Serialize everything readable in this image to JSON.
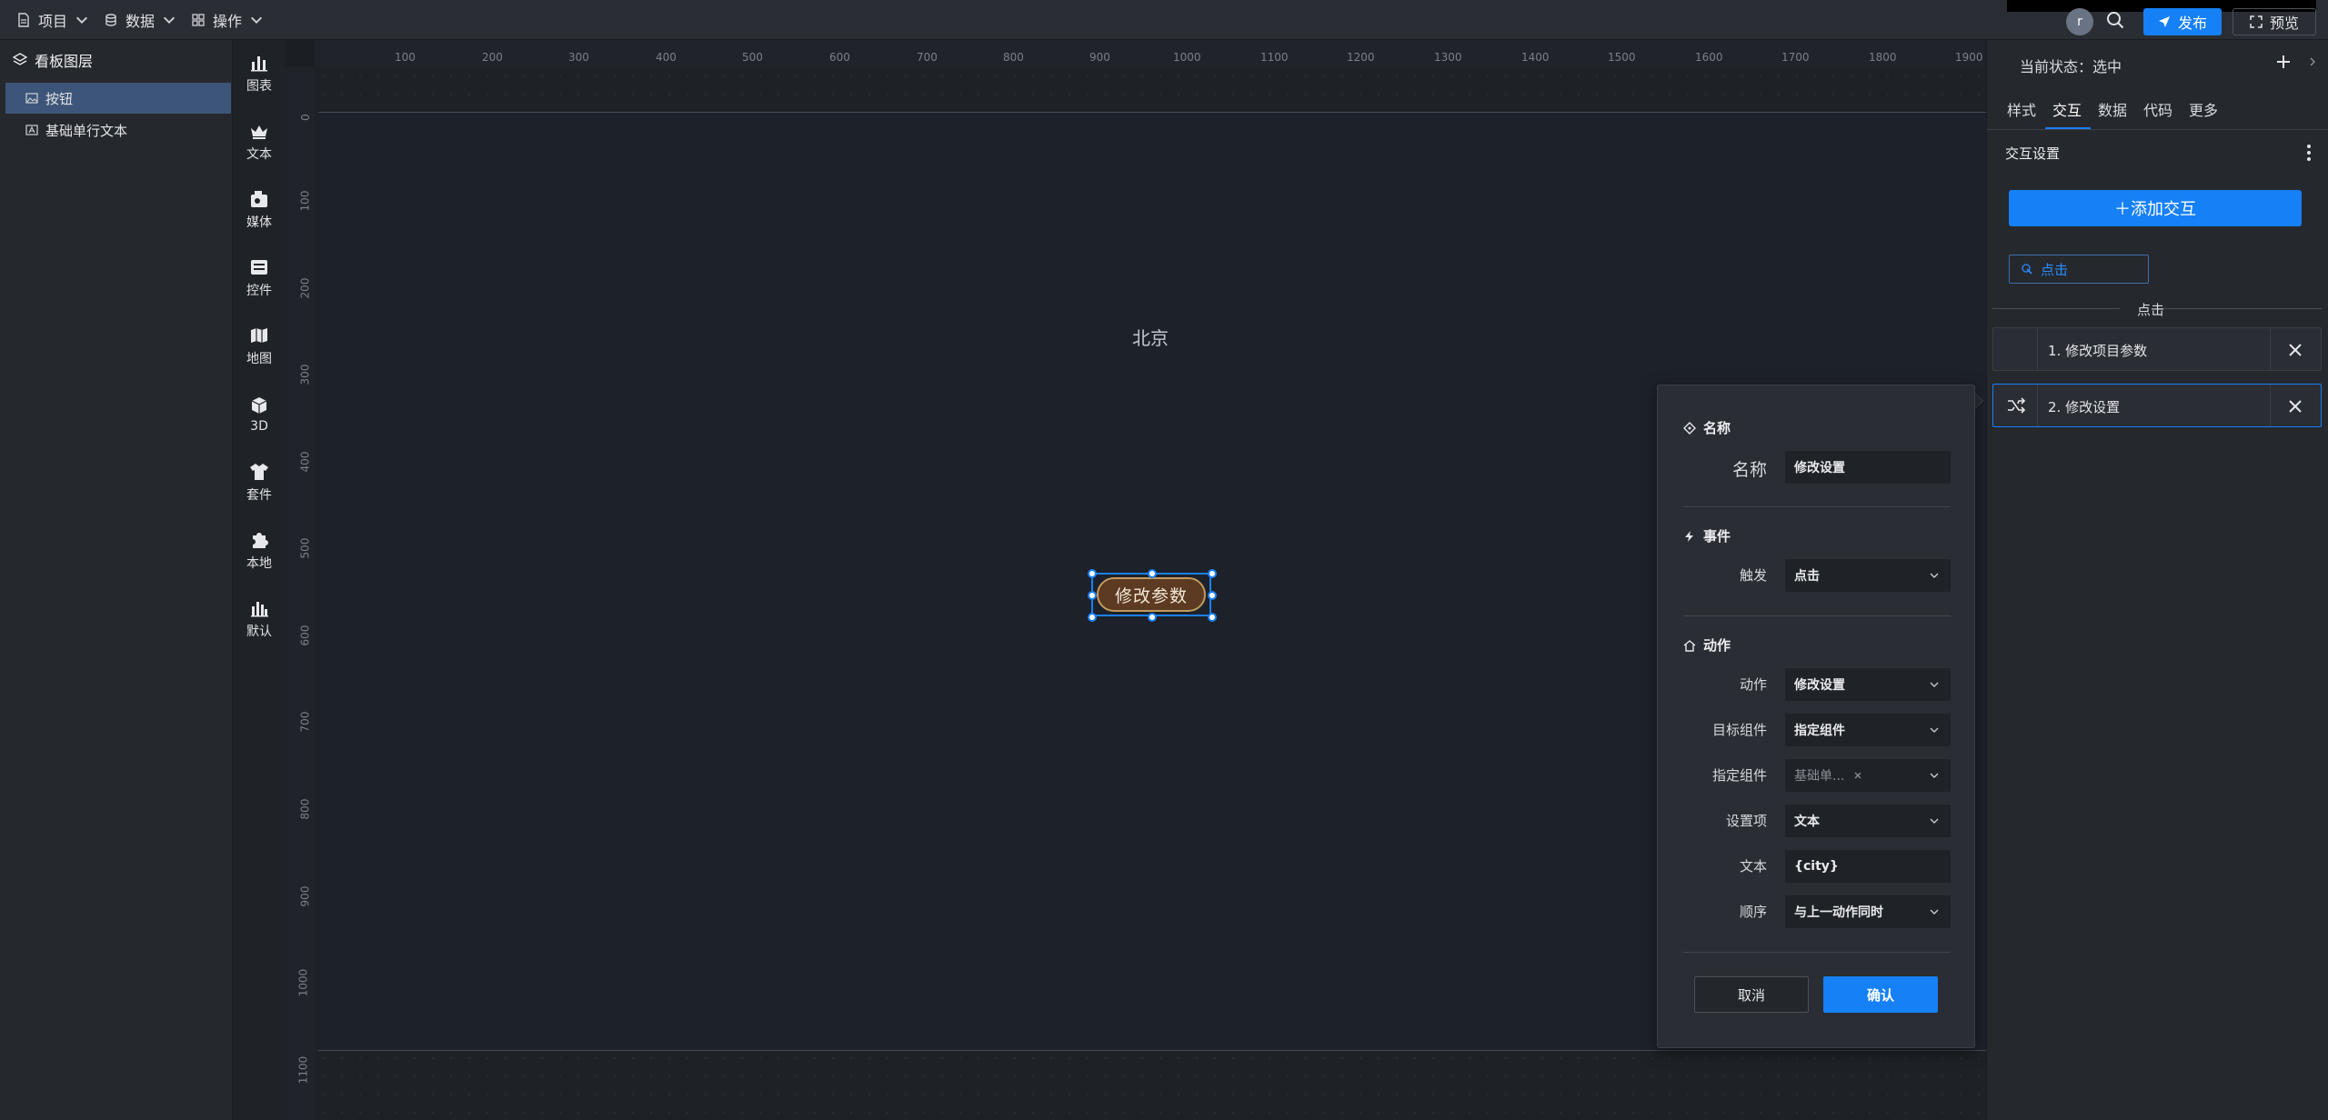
{
  "topbar": {
    "menus": [
      {
        "label": "项目",
        "icon": "file-icon"
      },
      {
        "label": "数据",
        "icon": "database-icon"
      },
      {
        "label": "操作",
        "icon": "grid-icon"
      }
    ],
    "avatar_letter": "r",
    "publish_label": "发布",
    "preview_label": "预览"
  },
  "layers": {
    "title": "看板图层",
    "items": [
      {
        "label": "按钮",
        "selected": true
      },
      {
        "label": "基础单行文本",
        "selected": false
      }
    ]
  },
  "components": [
    "图表",
    "文本",
    "媒体",
    "控件",
    "地图",
    "3D",
    "套件",
    "本地",
    "默认"
  ],
  "rulers": {
    "top": [
      "100",
      "200",
      "300",
      "400",
      "500",
      "600",
      "700",
      "800",
      "900",
      "1000",
      "1100",
      "1200",
      "1300",
      "1400",
      "1500",
      "1600",
      "1700",
      "1800",
      "1900"
    ],
    "left": [
      "0",
      "100",
      "200",
      "300",
      "400",
      "500",
      "600",
      "700",
      "800",
      "900",
      "1000",
      "1100"
    ]
  },
  "canvas": {
    "text_widget": "北京",
    "button_label": "修改参数"
  },
  "right_panel": {
    "current_state": "当前状态：选中",
    "tabs": [
      "样式",
      "交互",
      "数据",
      "代码",
      "更多"
    ],
    "active_tab": "交互",
    "section_title": "交互设置",
    "add_interaction": "＋添加交互",
    "event_tag": "点击",
    "divider_label": "点击",
    "actions": [
      {
        "label": "1. 修改项目参数",
        "selected": false
      },
      {
        "label": "2. 修改设置",
        "selected": true
      }
    ]
  },
  "popup": {
    "name_section": "名称",
    "name_label": "名称",
    "name_value": "修改设置",
    "event_section": "事件",
    "trigger_label": "触发",
    "trigger_value": "点击",
    "action_section": "动作",
    "action_label": "动作",
    "action_value": "修改设置",
    "target_label": "目标组件",
    "target_value": "指定组件",
    "specified_label": "指定组件",
    "specified_value": "基础单...",
    "setting_label": "设置项",
    "setting_value": "文本",
    "text_label": "文本",
    "text_value": "{city}",
    "order_label": "顺序",
    "order_value": "与上一动作同时",
    "cancel": "取消",
    "confirm": "确认"
  },
  "colors": {
    "accent": "#1680f7",
    "button_fill": "#5d3a22",
    "button_border": "#c19a5c"
  }
}
